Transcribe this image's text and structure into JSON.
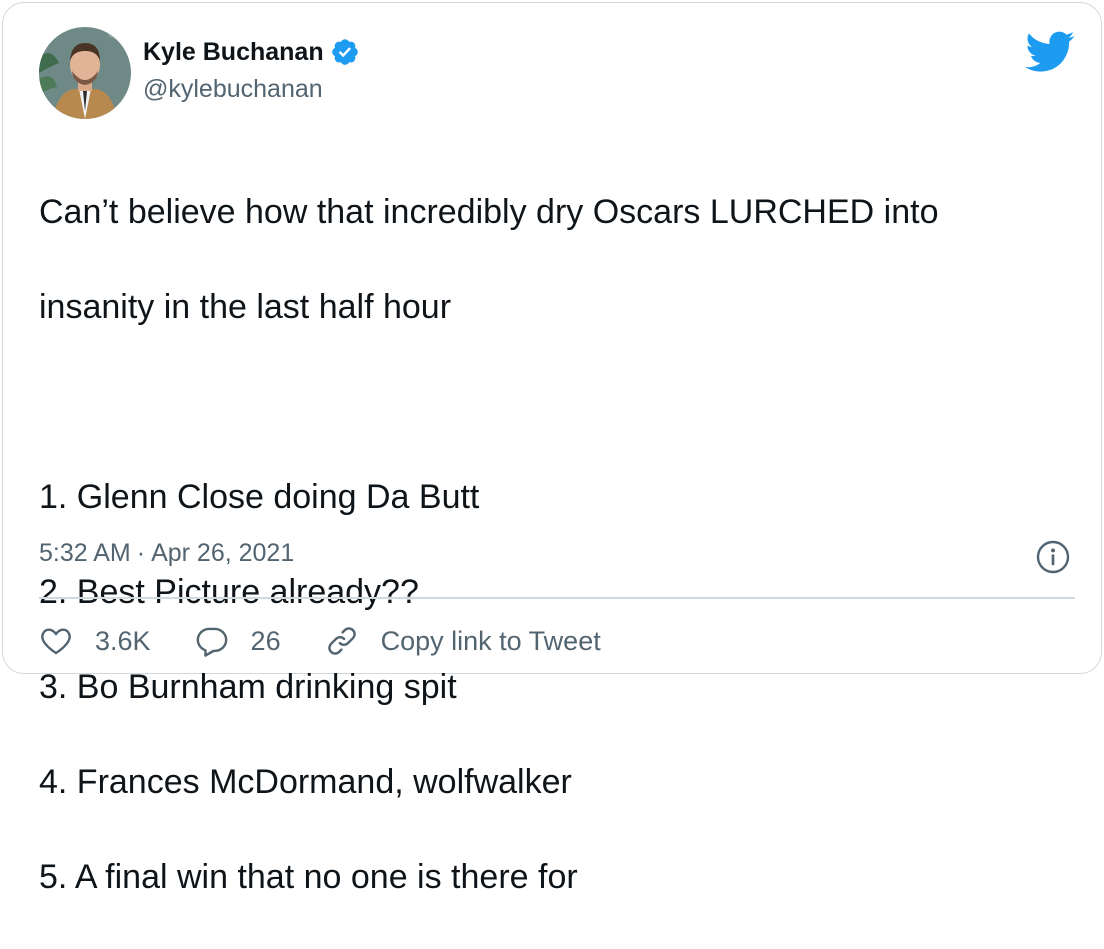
{
  "author": {
    "name": "Kyle Buchanan",
    "handle": "@kylebuchanan",
    "verified_icon": "verified-badge-icon",
    "avatar": "profile-photo"
  },
  "brand": {
    "icon": "twitter-bird-icon",
    "color": "#1d9bf0"
  },
  "tweet": {
    "lines": [
      "Can’t believe how that incredibly dry Oscars LURCHED into",
      "insanity in the last half hour",
      "",
      "1. Glenn Close doing Da Butt",
      "2. Best Picture already??",
      "3. Bo Burnham drinking spit",
      "4. Frances McDormand, wolfwalker",
      "5. A final win that no one is there for"
    ]
  },
  "meta": {
    "time": "5:32 AM",
    "separator": "·",
    "date": "Apr 26, 2021",
    "info_icon": "info-icon"
  },
  "actions": {
    "like": {
      "icon": "heart-icon",
      "label": "3.6K"
    },
    "reply": {
      "icon": "reply-bubble-icon",
      "label": "26"
    },
    "copy": {
      "icon": "link-icon",
      "label": "Copy link to Tweet"
    }
  },
  "colors": {
    "text": "#0f1419",
    "secondary": "#536471",
    "border": "#cfd9de",
    "accent": "#1d9bf0"
  }
}
